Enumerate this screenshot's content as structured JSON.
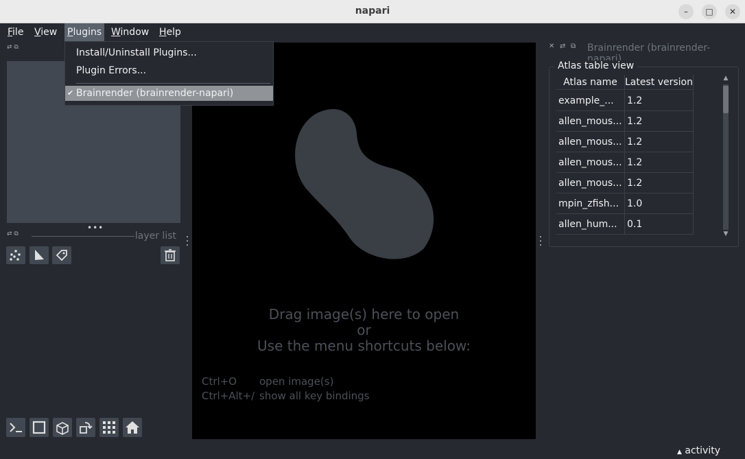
{
  "window": {
    "title": "napari"
  },
  "menubar": {
    "items": [
      {
        "label": "File",
        "underline": "F",
        "rest": "ile"
      },
      {
        "label": "View",
        "underline": "V",
        "rest": "iew"
      },
      {
        "label": "Plugins",
        "underline": "P",
        "rest": "lugins"
      },
      {
        "label": "Window",
        "underline": "W",
        "rest": "indow"
      },
      {
        "label": "Help",
        "underline": "H",
        "rest": "elp"
      }
    ]
  },
  "plugins_menu": {
    "items": [
      {
        "label": "Install/Uninstall Plugins..."
      },
      {
        "label": "Plugin Errors..."
      },
      {
        "label": "Brainrender (brainrender-napari)",
        "checked": true
      }
    ]
  },
  "left_dock": {
    "layer_list_label": "layer list"
  },
  "canvas": {
    "welcome_line1": "Drag image(s) here to open",
    "welcome_line2": "or",
    "welcome_line3": "Use the menu shortcuts below:",
    "shortcuts": [
      {
        "key": "Ctrl+O",
        "desc": "open image(s)"
      },
      {
        "key": "Ctrl+Alt+/",
        "desc": "show all key bindings"
      }
    ]
  },
  "right_dock": {
    "title": "Brainrender (brainrender-napari)",
    "group_title": "Atlas table view",
    "table": {
      "headers": [
        "Atlas name",
        "Latest version"
      ],
      "rows": [
        [
          "example_...",
          "1.2"
        ],
        [
          "allen_mous...",
          "1.2"
        ],
        [
          "allen_mous...",
          "1.2"
        ],
        [
          "allen_mous...",
          "1.2"
        ],
        [
          "allen_mous...",
          "1.2"
        ],
        [
          "mpin_zfish...",
          "1.0"
        ],
        [
          "allen_hum...",
          "0.1"
        ]
      ]
    }
  },
  "status": {
    "activity_label": "activity"
  },
  "colors": {
    "background": "#262930",
    "canvas": "#000000",
    "panel": "#414851",
    "accent_selected": "#909498"
  }
}
